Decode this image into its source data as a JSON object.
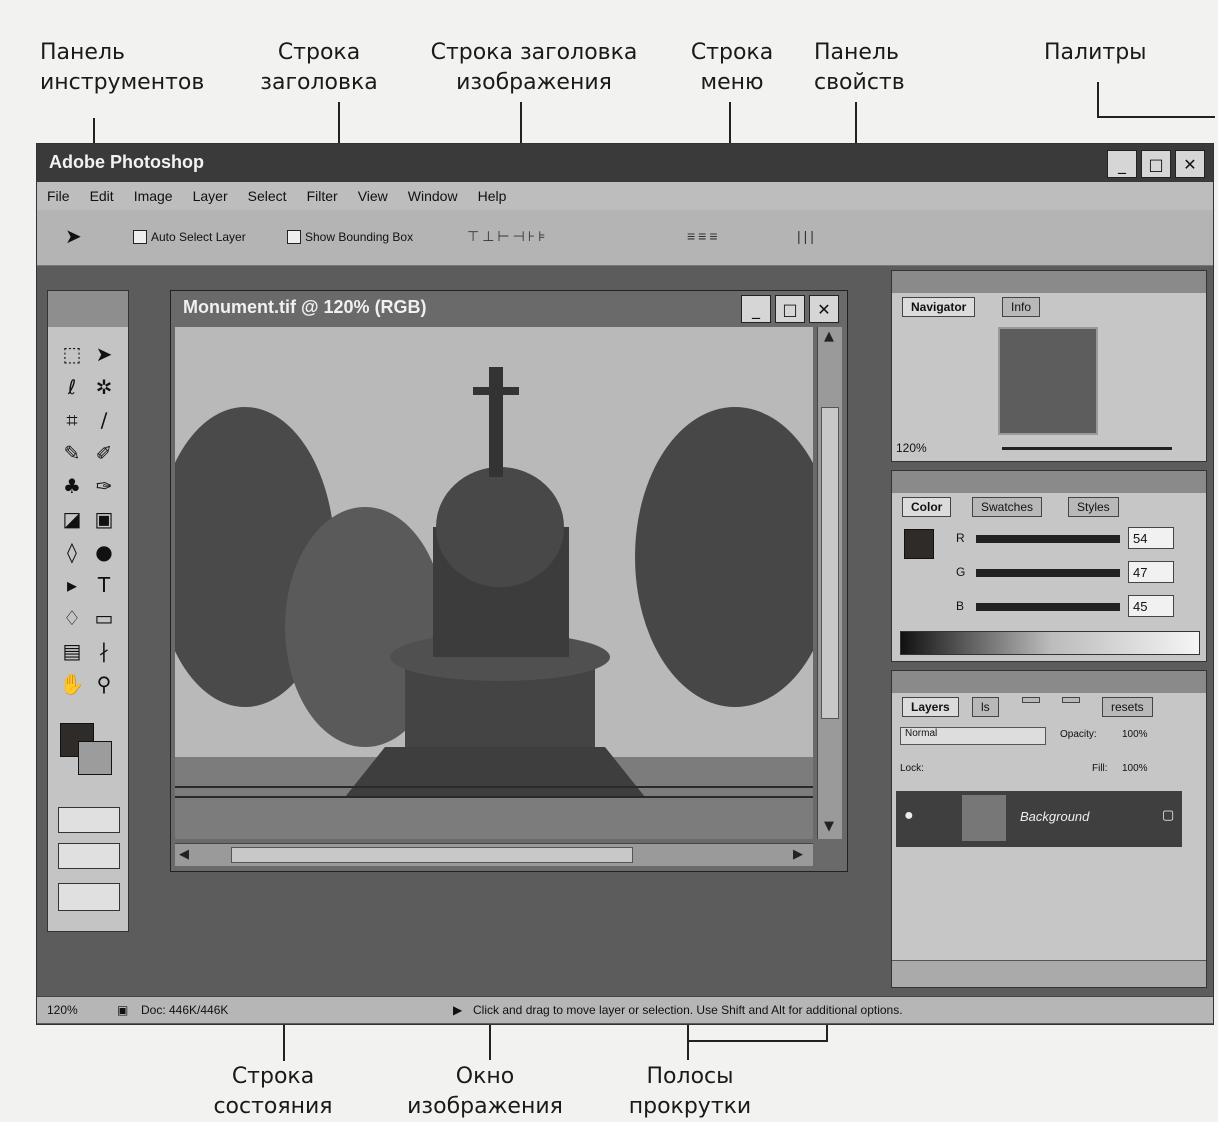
{
  "callouts": {
    "tools_panel": "Панель\nинструментов",
    "title_bar": "Строка\nзаголовка",
    "image_title_bar": "Строка заголовка\nизображения",
    "menu_bar": "Строка\nменю",
    "options_bar": "Панель\nсвойств",
    "palettes": "Палитры",
    "status_bar": "Строка\nсостояния",
    "image_window": "Окно\nизображения",
    "scrollbars": "Полосы\nпрокрутки"
  },
  "app": {
    "title": "Adobe Photoshop",
    "menu": [
      "File",
      "Edit",
      "Image",
      "Layer",
      "Select",
      "Filter",
      "View",
      "Window",
      "Help"
    ],
    "options": {
      "auto_select": "Auto Select Layer",
      "show_bounding": "Show Bounding Box"
    },
    "image_window_title": "Monument.tif @ 120% (RGB)",
    "navigator": {
      "tabs": [
        "Navigator",
        "Info"
      ],
      "zoom": "120%"
    },
    "color": {
      "tabs": [
        "Color",
        "Swatches",
        "Styles"
      ],
      "r_label": "R",
      "g_label": "G",
      "b_label": "B",
      "r": "54",
      "g": "47",
      "b": "45"
    },
    "layers": {
      "tabs": [
        "Layers",
        "ls",
        "",
        "",
        "resets"
      ],
      "layer_name": "Background",
      "mode": "Normal",
      "opacity_label": "Opacity:",
      "opacity": "100%",
      "lock_label": "Lock:",
      "fill_label": "Fill:",
      "fill": "100%"
    },
    "status": {
      "zoom": "120%",
      "doc": "Doc: 446K/446K",
      "hint": "Click and drag to move layer or selection. Use Shift and Alt for additional options."
    }
  }
}
